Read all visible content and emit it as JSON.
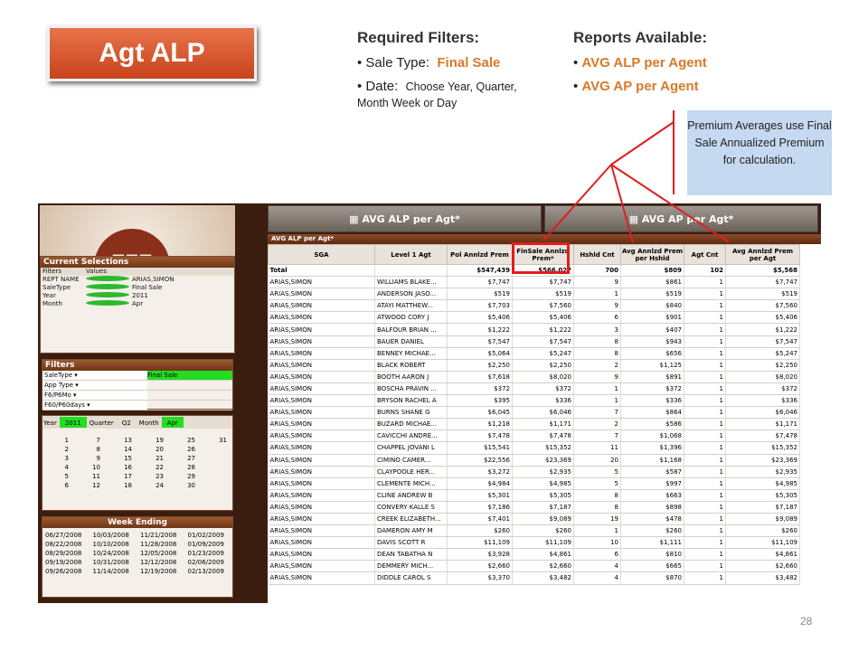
{
  "slide": {
    "title": "Agt ALP",
    "required_filters_header": "Required Filters:",
    "filter_sale_type_label": "Sale Type:",
    "filter_sale_type_value": "Final Sale",
    "filter_date_label": "Date:",
    "filter_date_note_line1": "Choose Year, Quarter,",
    "filter_date_note_line2": "Month Week or Day",
    "reports_header": "Reports Available:",
    "report1": "AVG ALP per Agent",
    "report2": "AVG AP per Agent",
    "callout": "Premium Averages use Final Sale Annualized Premium for calculation.",
    "page_number": "28"
  },
  "app": {
    "current_selections": {
      "title": "Current Selections",
      "col_filters": "Filters",
      "col_values": "Values",
      "rows": [
        {
          "filter": "REPT NAME",
          "value": "ARIAS,SIMON"
        },
        {
          "filter": "SaleType",
          "value": "Final Sale"
        },
        {
          "filter": "Year",
          "value": "2011"
        },
        {
          "filter": "Month",
          "value": "Apr"
        }
      ]
    },
    "filters": {
      "title": "Filters",
      "rows": [
        {
          "label": "SaleType",
          "value": "Final Sale"
        },
        {
          "label": "App Type",
          "value": ""
        },
        {
          "label": "F6/P6Mo",
          "value": ""
        },
        {
          "label": "F60/P60days",
          "value": ""
        }
      ]
    },
    "calendar": {
      "year_label": "Year",
      "year_value": "2011",
      "quarter_label": "Quarter",
      "quarter_value": "Q2",
      "month_label": "Month",
      "month_value": "Apr",
      "rows": [
        [
          "1",
          "7",
          "13",
          "19",
          "25",
          "31"
        ],
        [
          "2",
          "8",
          "14",
          "20",
          "26",
          ""
        ],
        [
          "3",
          "9",
          "15",
          "21",
          "27",
          ""
        ],
        [
          "4",
          "10",
          "16",
          "22",
          "28",
          ""
        ],
        [
          "5",
          "11",
          "17",
          "23",
          "29",
          ""
        ],
        [
          "6",
          "12",
          "18",
          "24",
          "30",
          ""
        ]
      ]
    },
    "week_ending": {
      "title": "Week Ending",
      "rows": [
        [
          "06/27/2008",
          "10/03/2008",
          "11/21/2008",
          "01/02/2009"
        ],
        [
          "08/22/2008",
          "10/10/2008",
          "11/28/2008",
          "01/09/2009"
        ],
        [
          "08/29/2008",
          "10/24/2008",
          "12/05/2008",
          "01/23/2009"
        ],
        [
          "09/19/2008",
          "10/31/2008",
          "12/12/2008",
          "02/06/2009"
        ],
        [
          "09/26/2008",
          "11/14/2008",
          "12/19/2008",
          "02/13/2009"
        ]
      ]
    },
    "tab1": "AVG ALP per Agt*",
    "tab2": "AVG AP per Agt*",
    "table_title": "AVG ALP per Agt*",
    "columns": [
      "SGA",
      "Level 1 Agt",
      "Pol Annlzd Prem",
      "FinSale Annlzd Prem*",
      "Hshld Cnt",
      "Avg Annlzd Prem per Hshld",
      "Agt Cnt",
      "Avg Annlzd Prem per Agt"
    ],
    "total": [
      "Total",
      "",
      "$547,439",
      "$566,027",
      "700",
      "$809",
      "102",
      "$5,568"
    ],
    "rows": [
      [
        "ARIAS,SIMON",
        "WILLIAMS BLAKE...",
        "$7,747",
        "$7,747",
        "9",
        "$861",
        "1",
        "$7,747"
      ],
      [
        "ARIAS,SIMON",
        "ANDERSON JASO...",
        "$519",
        "$519",
        "1",
        "$519",
        "1",
        "$519"
      ],
      [
        "ARIAS,SIMON",
        "ATAYI MATTHEW...",
        "$7,703",
        "$7,560",
        "9",
        "$840",
        "1",
        "$7,560"
      ],
      [
        "ARIAS,SIMON",
        "ATWOOD CORY J",
        "$5,406",
        "$5,406",
        "6",
        "$901",
        "1",
        "$5,406"
      ],
      [
        "ARIAS,SIMON",
        "BALFOUR BRIAN ...",
        "$1,222",
        "$1,222",
        "3",
        "$407",
        "1",
        "$1,222"
      ],
      [
        "ARIAS,SIMON",
        "BAUER DANIEL",
        "$7,547",
        "$7,547",
        "8",
        "$943",
        "1",
        "$7,547"
      ],
      [
        "ARIAS,SIMON",
        "BENNEY MICHAE...",
        "$5,064",
        "$5,247",
        "8",
        "$656",
        "1",
        "$5,247"
      ],
      [
        "ARIAS,SIMON",
        "BLACK ROBERT",
        "$2,250",
        "$2,250",
        "2",
        "$1,125",
        "1",
        "$2,250"
      ],
      [
        "ARIAS,SIMON",
        "BOOTH AARON J",
        "$7,618",
        "$8,020",
        "9",
        "$891",
        "1",
        "$8,020"
      ],
      [
        "ARIAS,SIMON",
        "BOSCHA PRAVIN ...",
        "$372",
        "$372",
        "1",
        "$372",
        "1",
        "$372"
      ],
      [
        "ARIAS,SIMON",
        "BRYSON RACHEL A",
        "$395",
        "$336",
        "1",
        "$336",
        "1",
        "$336"
      ],
      [
        "ARIAS,SIMON",
        "BURNS SHANE G",
        "$6,045",
        "$6,046",
        "7",
        "$864",
        "1",
        "$6,046"
      ],
      [
        "ARIAS,SIMON",
        "BUZARD MICHAE...",
        "$1,218",
        "$1,171",
        "2",
        "$586",
        "1",
        "$1,171"
      ],
      [
        "ARIAS,SIMON",
        "CAVICCHI ANDRE...",
        "$7,478",
        "$7,478",
        "7",
        "$1,068",
        "1",
        "$7,478"
      ],
      [
        "ARIAS,SIMON",
        "CHAPPEL JOVANI L",
        "$15,541",
        "$15,352",
        "11",
        "$1,396",
        "1",
        "$15,352"
      ],
      [
        "ARIAS,SIMON",
        "CIMINO CAMER...",
        "$22,556",
        "$23,369",
        "20",
        "$1,168",
        "1",
        "$23,369"
      ],
      [
        "ARIAS,SIMON",
        "CLAYPOOLE HER...",
        "$3,272",
        "$2,935",
        "5",
        "$587",
        "1",
        "$2,935"
      ],
      [
        "ARIAS,SIMON",
        "CLEMENTE MICH...",
        "$4,984",
        "$4,985",
        "5",
        "$997",
        "1",
        "$4,985"
      ],
      [
        "ARIAS,SIMON",
        "CLINE ANDREW B",
        "$5,301",
        "$5,305",
        "8",
        "$663",
        "1",
        "$5,305"
      ],
      [
        "ARIAS,SIMON",
        "CONVERY KALLE S",
        "$7,186",
        "$7,187",
        "8",
        "$898",
        "1",
        "$7,187"
      ],
      [
        "ARIAS,SIMON",
        "CREEK ELIZABETH...",
        "$7,401",
        "$9,089",
        "19",
        "$478",
        "1",
        "$9,089"
      ],
      [
        "ARIAS,SIMON",
        "DAMERON AMY M",
        "$260",
        "$260",
        "1",
        "$260",
        "1",
        "$260"
      ],
      [
        "ARIAS,SIMON",
        "DAVIS SCOTT R",
        "$11,109",
        "$11,109",
        "10",
        "$1,111",
        "1",
        "$11,109"
      ],
      [
        "ARIAS,SIMON",
        "DEAN TABATHA N",
        "$3,928",
        "$4,861",
        "6",
        "$810",
        "1",
        "$4,861"
      ],
      [
        "ARIAS,SIMON",
        "DEMMERY MICH...",
        "$2,660",
        "$2,660",
        "4",
        "$665",
        "1",
        "$2,660"
      ],
      [
        "ARIAS,SIMON",
        "DIDDLE CAROL S",
        "$3,370",
        "$3,482",
        "4",
        "$870",
        "1",
        "$3,482"
      ]
    ]
  }
}
